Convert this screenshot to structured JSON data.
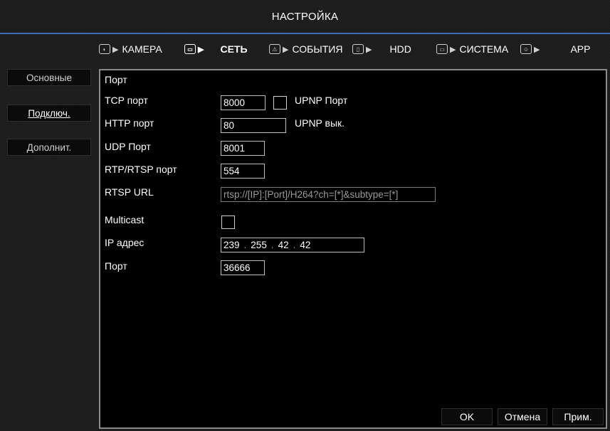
{
  "window": {
    "title": "НАСТРОЙКА"
  },
  "tabs": [
    {
      "label": "КАМЕРА",
      "icon": "camera-icon",
      "selected": false
    },
    {
      "label": "СЕТЬ",
      "icon": "network-icon",
      "selected": true
    },
    {
      "label": "СОБЫТИЯ",
      "icon": "alarm-icon",
      "selected": false
    },
    {
      "label": "HDD",
      "icon": "storage-icon",
      "selected": false
    },
    {
      "label": "СИСТЕМА",
      "icon": "monitor-icon",
      "selected": false
    },
    {
      "label": "APP",
      "icon": "app-icon",
      "selected": false
    }
  ],
  "sidebar": {
    "items": [
      {
        "label": "Основные"
      },
      {
        "label": "Подключ.",
        "active": true
      },
      {
        "label": "Дополнит."
      }
    ]
  },
  "form": {
    "section_title": "Порт",
    "tcp_label": "TCP порт",
    "tcp_value": "8000",
    "upnp_port_label": "UPNP Порт",
    "http_label": "HTTP порт",
    "http_value": "80",
    "upnp_off_label": "UPNP вык.",
    "udp_label": "UDP Порт",
    "udp_value": "8001",
    "rtsp_label": "RTP/RTSP порт",
    "rtsp_value": "554",
    "rtsp_url_label": "RTSP URL",
    "rtsp_url_value": "rtsp://[IP]:[Port]/H264?ch=[*]&subtype=[*]",
    "multicast_label": "Multicast",
    "ip_label": "IP адрес",
    "ip_octets": [
      "239",
      "255",
      "42",
      "42"
    ],
    "port_label": "Порт",
    "port_value": "36666"
  },
  "buttons": {
    "ok": "OK",
    "cancel": "Отмена",
    "apply": "Прим."
  },
  "colors": {
    "accent": "#3a6fb5",
    "panel_border": "#8a8a8a",
    "background": "#1c1c1c"
  }
}
